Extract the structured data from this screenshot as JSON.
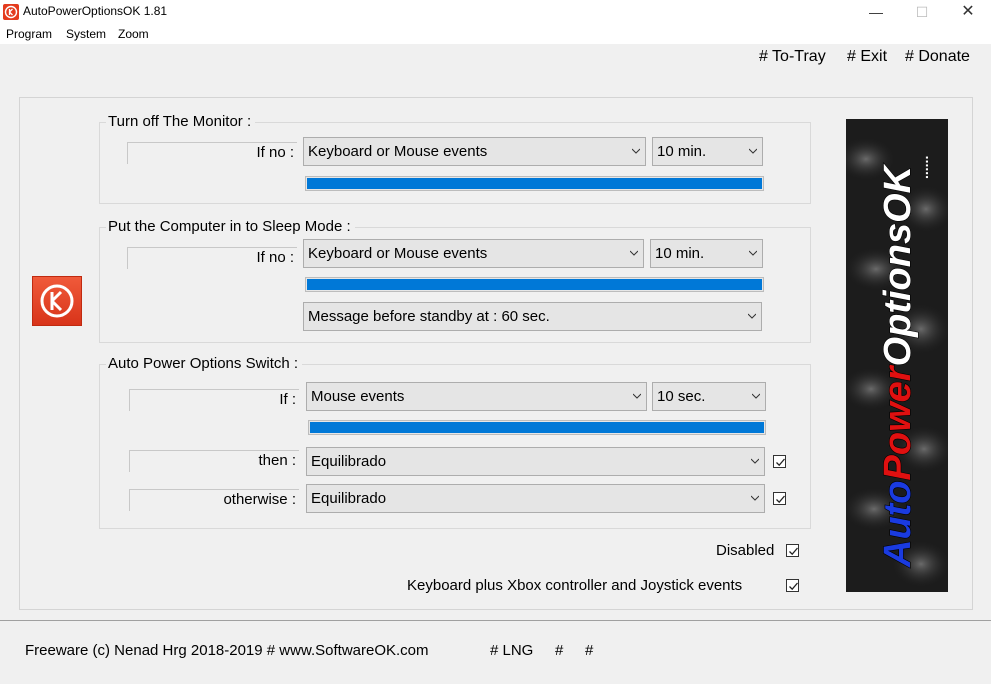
{
  "window": {
    "title": "AutoPowerOptionsOK 1.81",
    "minimize_glyph": "—",
    "maximize_glyph": "☐",
    "close_glyph": "✕"
  },
  "menu": [
    "Program",
    "System",
    "Zoom"
  ],
  "top_links": [
    "# To-Tray",
    "# Exit",
    "# Donate"
  ],
  "monitor": {
    "title": "Turn off The Monitor :",
    "label": "If no :",
    "event": "Keyboard or Mouse events",
    "time": "10 min.",
    "progress": 1.0
  },
  "sleep": {
    "title": "Put the Computer in to Sleep Mode :",
    "label": "If no :",
    "event": "Keyboard or Mouse events",
    "time": "10 min.",
    "progress": 1.0,
    "message": "Message before standby at : 60 sec."
  },
  "switch": {
    "title": "Auto Power Options Switch :",
    "if_label": "If :",
    "event": "Mouse events",
    "time": "10 sec.",
    "progress": 1.0,
    "then_label": "then :",
    "then_plan": "Equilibrado",
    "then_checked": true,
    "otherwise_label": "otherwise :",
    "otherwise_plan": "Equilibrado",
    "otherwise_checked": true
  },
  "options": {
    "disabled_label": "Disabled",
    "disabled_checked": true,
    "xbox_label": "Keyboard plus Xbox controller and Joystick events",
    "xbox_checked": true
  },
  "banner": {
    "auto": "Auto",
    "power": "Power",
    "options": "Options",
    "ok": "OK",
    "dots": "......",
    "colors": {
      "auto": "#1a3be0",
      "power": "#e01010",
      "options": "#ffffff",
      "ok": "#ffffff"
    }
  },
  "footer": {
    "copyright": "Freeware (c) Nenad Hrg 2018-2019 # www.SoftwareOK.com",
    "lng": "# LNG",
    "hash1": "#",
    "hash2": "#"
  },
  "colors": {
    "accent": "#0078d7",
    "logo": "#e43b1e"
  }
}
